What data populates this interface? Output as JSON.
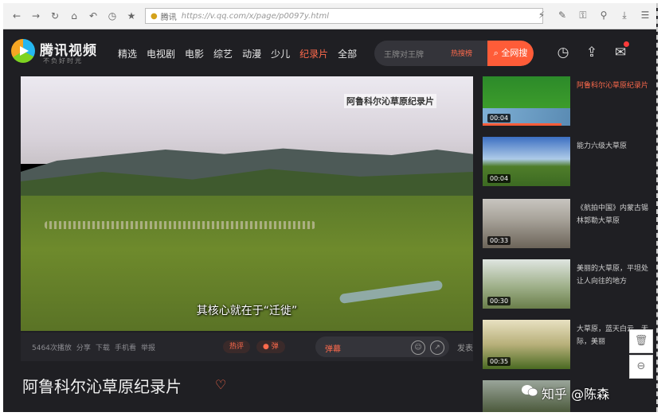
{
  "browser": {
    "site_label": "腾讯",
    "url": "https://v.qq.com/x/page/p0097y.html"
  },
  "header": {
    "brand": "腾讯视频",
    "slogan": "不负好时光",
    "channels": [
      {
        "label": "精选",
        "active": false
      },
      {
        "label": "电视剧",
        "active": false
      },
      {
        "label": "电影",
        "active": false
      },
      {
        "label": "综艺",
        "active": false
      },
      {
        "label": "动漫",
        "active": false
      },
      {
        "label": "少儿",
        "active": false
      },
      {
        "label": "纪录片",
        "active": true
      },
      {
        "label": "全部",
        "active": false
      }
    ],
    "search_placeholder": "王牌对王牌",
    "search_hot": "热搜榜",
    "search_button": "全网搜"
  },
  "player": {
    "video_title": "阿鲁科尔沁草原纪录片",
    "subtitle": "其核心就在于“迁徙”"
  },
  "toolbar": {
    "items": [
      "5464次播放",
      "分享",
      "下载",
      "手机看",
      "举报"
    ],
    "pill_1": "热评",
    "pill_2": "弹",
    "danmu_label": "弹幕",
    "send": "发表"
  },
  "page": {
    "title": "阿鲁科尔沁草原纪录片"
  },
  "recommendations": [
    {
      "title": "阿鲁科尔沁草原纪录片",
      "duration": "00:04",
      "active": true,
      "progress": 0.9
    },
    {
      "title": "能力六级大草原",
      "duration": "00:04",
      "active": false
    },
    {
      "title": "《航拍中国》内蒙古锡林郭勒大草原",
      "duration": "00:33",
      "active": false
    },
    {
      "title": "美丽的大草原，平坦处让人向往的地方",
      "duration": "00:30",
      "active": false
    },
    {
      "title": "大草原，蓝天白云，无际，美丽",
      "duration": "00:35",
      "active": false
    }
  ],
  "watermark": "知乎 @陈森",
  "colors": {
    "accent": "#ff5c38",
    "bg": "#1f1f23"
  }
}
